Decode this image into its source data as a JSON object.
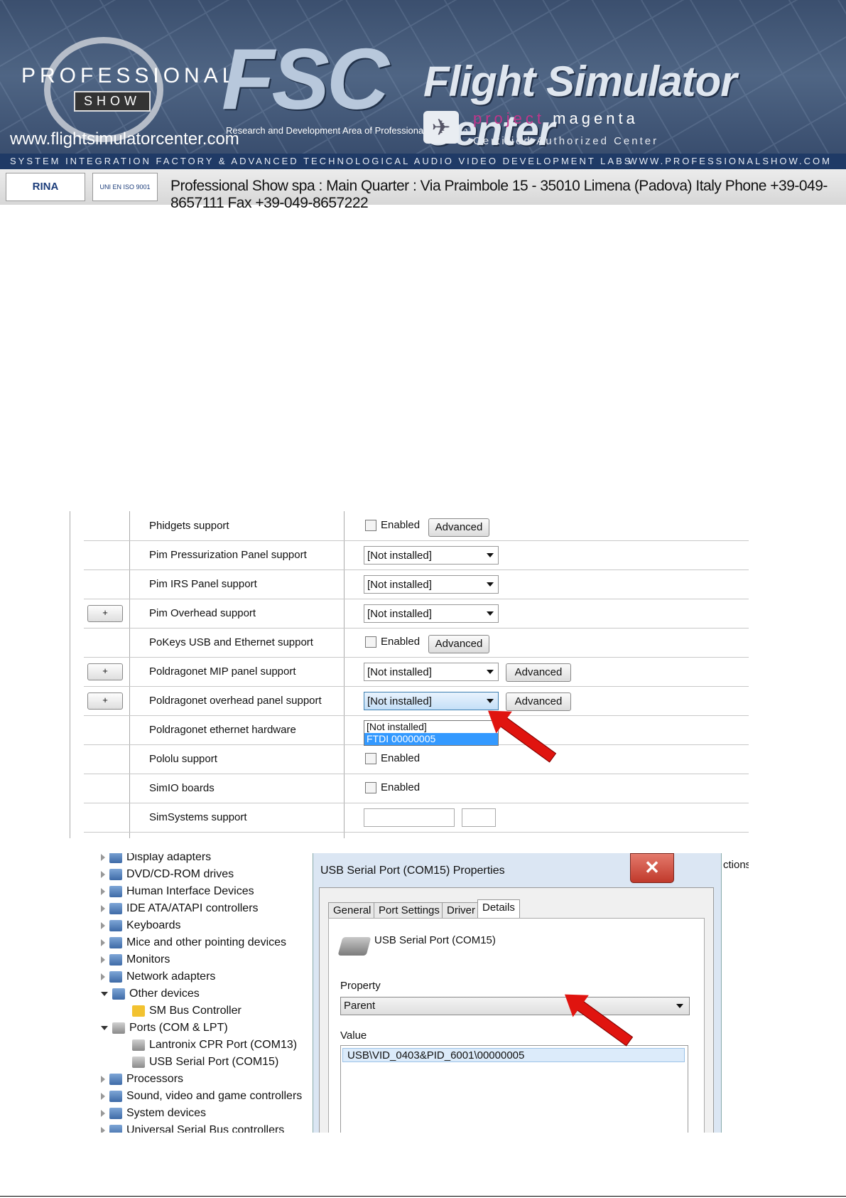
{
  "header": {
    "ps_brand": "PROFESSIONAL",
    "ps_show": "SHOW",
    "website": "www.flightsimulatorcenter.com",
    "fsc": "FSC",
    "fsc_sub": "Research and Development Area of Professional Show S.p.a.",
    "title": "Flight Simulator Center",
    "pm_project": "project",
    "pm_magenta": "magenta",
    "certified": "Certified Authorized Center",
    "band_left": "SYSTEM INTEGRATION FACTORY & ADVANCED TECHNOLOGICAL AUDIO VIDEO DEVELOPMENT LABS",
    "band_right": "WWW.PROFESSIONALSHOW.COM",
    "rina": "RINA",
    "address": "Professional Show spa : Main Quarter : Via Praimbole 15 - 35010 Limena (Padova) Italy  Phone +39-049-8657111  Fax +39-049-8657222",
    "brand_color": "#1f3a66"
  },
  "settings_table": {
    "rows": [
      {
        "label": "Phidgets support",
        "control": "checkbox",
        "checkbox_label": "Enabled",
        "button": "Advanced"
      },
      {
        "label": "Pim Pressurization Panel support",
        "control": "select",
        "value": "[Not installed]"
      },
      {
        "label": "Pim IRS Panel support",
        "control": "select",
        "value": "[Not installed]"
      },
      {
        "label": "Pim Overhead support",
        "control": "select",
        "value": "[Not installed]",
        "plus": "+"
      },
      {
        "label": "PoKeys USB and Ethernet support",
        "control": "checkbox",
        "checkbox_label": "Enabled",
        "button": "Advanced"
      },
      {
        "label": "Poldragonet MIP panel support",
        "control": "select",
        "value": "[Not installed]",
        "plus": "+",
        "button": "Advanced"
      },
      {
        "label": "Poldragonet overhead panel support",
        "control": "select",
        "value": "[Not installed]",
        "plus": "+",
        "button": "Advanced"
      },
      {
        "label": "Poldragonet ethernet hardware",
        "control": "none"
      },
      {
        "label": "Pololu support",
        "control": "checkbox",
        "checkbox_label": "Enabled"
      },
      {
        "label": "SimIO boards",
        "control": "checkbox",
        "checkbox_label": "Enabled"
      },
      {
        "label": "SimSystems support",
        "control": "textboxes"
      }
    ],
    "dropdown_options": [
      "[Not installed]",
      "FTDI 00000005"
    ],
    "dropdown_selected": "FTDI 00000005"
  },
  "device_manager": {
    "tree": [
      {
        "label": "Display adapters",
        "open": false
      },
      {
        "label": "DVD/CD-ROM drives",
        "open": false
      },
      {
        "label": "Human Interface Devices",
        "open": false
      },
      {
        "label": "IDE ATA/ATAPI controllers",
        "open": false
      },
      {
        "label": "Keyboards",
        "open": false
      },
      {
        "label": "Mice and other pointing devices",
        "open": false
      },
      {
        "label": "Monitors",
        "open": false
      },
      {
        "label": "Network adapters",
        "open": false
      },
      {
        "label": "Other devices",
        "open": true
      },
      {
        "label": "SM Bus Controller",
        "child": true
      },
      {
        "label": "Ports (COM & LPT)",
        "open": true
      },
      {
        "label": "Lantronix CPR Port (COM13)",
        "child": true
      },
      {
        "label": "USB Serial Port (COM15)",
        "child": true
      },
      {
        "label": "Processors",
        "open": false
      },
      {
        "label": "Sound, video and game controllers",
        "open": false
      },
      {
        "label": "System devices",
        "open": false
      },
      {
        "label": "Universal Serial Bus controllers",
        "open": false
      }
    ],
    "actions_fragment": "ctions",
    "dialog": {
      "title": "USB Serial Port (COM15) Properties",
      "close": "✕",
      "tabs": [
        "General",
        "Port Settings",
        "Driver",
        "Details"
      ],
      "active_tab": "Details",
      "device_name": "USB Serial Port (COM15)",
      "property_label": "Property",
      "property_value": "Parent",
      "value_label": "Value",
      "value": "USB\\VID_0403&PID_6001\\00000005"
    }
  },
  "arrow_color": "#e0140f"
}
